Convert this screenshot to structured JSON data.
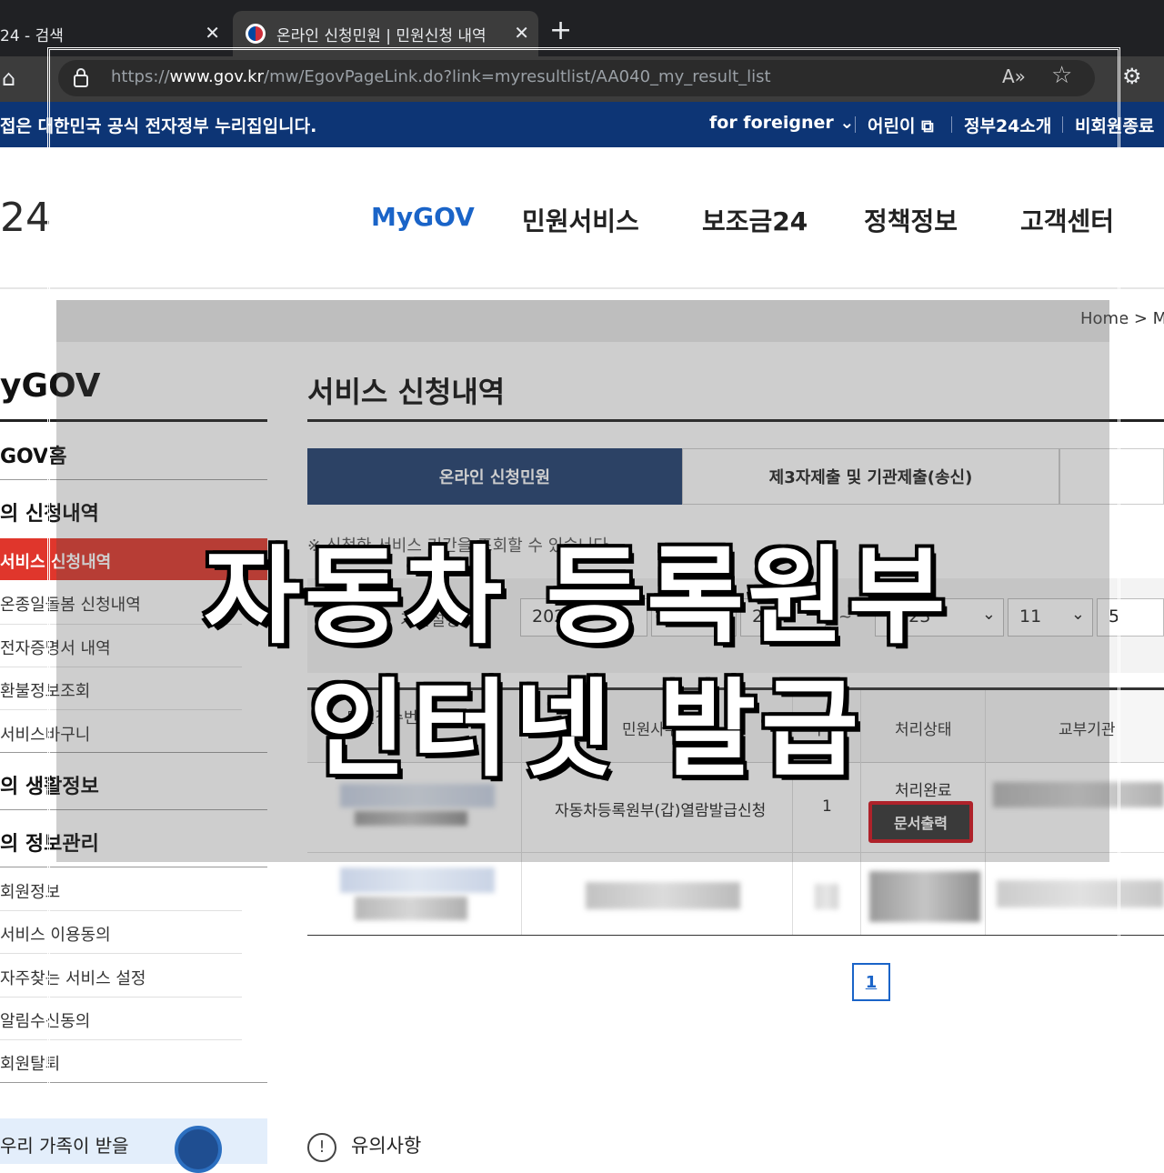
{
  "browser": {
    "tab1_title": "24 - 검색",
    "tab2_title": "온라인 신청민원 | 민원신청 내역",
    "url_prefix": "https://",
    "url_host": "www.gov.kr",
    "url_path": "/mw/EgovPageLink.do?link=myresultlist/AA040_my_result_list"
  },
  "govbar": {
    "notice": "접은 대한민국 공식 전자정부 누리집입니다.",
    "links": [
      "for foreigner",
      "어린이",
      "정부24소개",
      "비회원종료"
    ]
  },
  "header": {
    "logo": "24",
    "nav": [
      "MyGOV",
      "민원서비스",
      "보조금24",
      "정책정보",
      "고객센터"
    ]
  },
  "breadcrumb": "Home  >  My",
  "sidebar": {
    "title": "yGOV",
    "mygov_home": "GOV홈",
    "section1": "의 신청내역",
    "items1": [
      "서비스 신청내역",
      "온종일돌봄 신청내역",
      "전자증명서 내역",
      "환불정보조회",
      "서비스바구니"
    ],
    "section2": "의 생활정보",
    "section3": "의 정보관리",
    "items3": [
      "회원정보",
      "서비스 이용동의",
      "자주찾는 서비스 설정",
      "알림수신동의",
      "회원탈퇴"
    ],
    "banner": "우리 가족이 받을"
  },
  "main": {
    "title": "서비스 신청내역",
    "tabs": [
      "온라인 신청민원",
      "제3자제출 및 기관제출(송신)"
    ],
    "notice": "※ 신청한 서비스 기간을 조회할 수 있습니다.",
    "period_label": "기간설정",
    "from": [
      "2023",
      "11",
      "2"
    ],
    "to": [
      "2023",
      "11",
      "5"
    ],
    "tilde": "~",
    "columns": [
      "민원접수번호 / 신청일",
      "민원사무명",
      "수량",
      "처리상태",
      "교부기관"
    ],
    "row1": {
      "name": "자동차등록원부(갑)열람발급신청",
      "qty": "1",
      "status": "처리완료",
      "button": "문서출력"
    },
    "page": "1",
    "caution": "유의사항"
  },
  "overlay": {
    "line1": "자동차 등록원부",
    "line2": "인터넷 발급"
  },
  "colors": {
    "govbar": "#0d3575",
    "nav_active": "#1a64c8",
    "side_active": "#e0362c",
    "tab_active": "#1f3d6e",
    "print_border": "#d3111d"
  }
}
